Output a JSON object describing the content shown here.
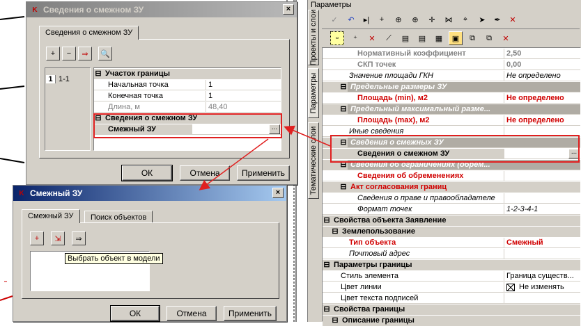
{
  "dialog_adjacent": {
    "title": "Сведения о смежном ЗУ",
    "tab": "Сведения о смежном ЗУ",
    "list_number": "1",
    "list_item": "1-1",
    "grid": {
      "cat_boundary": "Участок границы",
      "start_point_label": "Начальная точка",
      "start_point_value": "1",
      "end_point_label": "Конечная точка",
      "end_point_value": "1",
      "length_label": "Длина, м",
      "length_value": "48,40",
      "cat_adjacent": "Сведения о смежном ЗУ",
      "adjacent_label": "Смежный ЗУ",
      "dots": "..."
    },
    "buttons": {
      "ok": "ОК",
      "cancel": "Отмена",
      "apply": "Применить"
    }
  },
  "dialog_parcel": {
    "title": "Смежный ЗУ",
    "tabs": [
      "Смежный ЗУ",
      "Поиск объектов"
    ],
    "tooltip": "Выбрать объект в модели",
    "buttons": {
      "ok": "ОК",
      "cancel": "Отмена",
      "apply": "Применить"
    }
  },
  "params_panel": {
    "title": "Параметры",
    "side_tabs": [
      "Проекты и слои",
      "Параметры",
      "Тематические слои"
    ],
    "rows": [
      {
        "label": "Нормативный коэффициент",
        "value": "2,50"
      },
      {
        "label": "СКП точек",
        "value": "0,00"
      },
      {
        "label": "Значение площади ГКН",
        "value": "Не определено"
      },
      {
        "label": "Предельные размеры ЗУ"
      },
      {
        "label": "Площадь (min), м2",
        "value": "Не определено"
      },
      {
        "label": "Предельный максимальный разме..."
      },
      {
        "label": "Площадь (max), м2",
        "value": "Не определено"
      },
      {
        "label": "Иные сведения"
      },
      {
        "label": "Сведения о смежных ЗУ"
      },
      {
        "label": "Сведения о смежном ЗУ",
        "value": "..."
      },
      {
        "label": "Сведения об ограничениях (обрем..."
      },
      {
        "label": "Сведения об обременениях"
      },
      {
        "label": "Акт согласования границ"
      },
      {
        "label": "Сведения о праве и правообладателе"
      },
      {
        "label": "Формат точек",
        "value": "1-2-3-4-1"
      },
      {
        "label": "Свойства объекта Заявление"
      },
      {
        "label": "Землепользование"
      },
      {
        "label": "Тип объекта",
        "value": "Смежный"
      },
      {
        "label": "Почтовый адрес"
      },
      {
        "label": "Параметры границы"
      },
      {
        "label": "Стиль элемента",
        "value": "Граница существ..."
      },
      {
        "label": "Цвет линии",
        "value": "Не изменять"
      },
      {
        "label": "Цвет текста подписей"
      },
      {
        "label": "Свойства границы"
      },
      {
        "label": "Описание границы"
      }
    ]
  },
  "colors": {
    "highlight_red": "#e02020",
    "title_active": "#0a246a",
    "value_red": "#d00000"
  }
}
